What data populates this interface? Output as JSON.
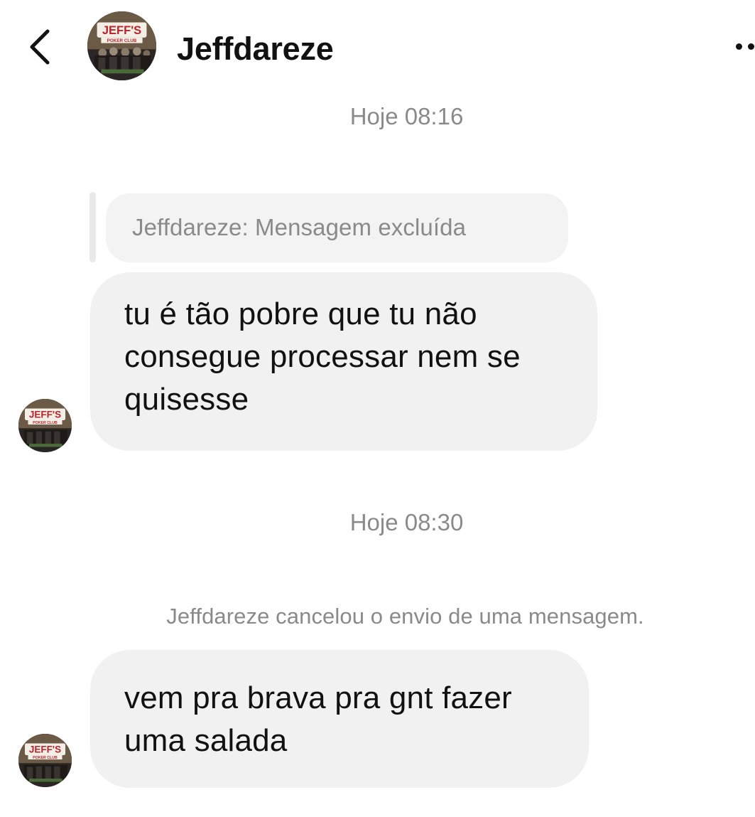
{
  "header": {
    "contact_name": "Jeffdareze",
    "avatar_text": "JEFF'S POKER CLUB",
    "back_icon": "chevron-left-icon",
    "more_icon": "more-dots-icon"
  },
  "thread": {
    "timestamp_1": "Hoje 08:16",
    "reply_quote": "Jeffdareze: Mensagem excluída",
    "message_1": [
      "tu é tão pobre que tu não",
      "consegue processar nem se",
      "quisesse"
    ],
    "timestamp_2": "Hoje 08:30",
    "system_notice": "Jeffdareze cancelou o envio de uma mensagem.",
    "message_2": [
      "vem pra brava pra gnt fazer",
      "uma salada"
    ]
  },
  "colors": {
    "bubble_background": "#f1f1f1",
    "meta_text": "#8a8a8a",
    "logo_red": "#b8242b"
  }
}
